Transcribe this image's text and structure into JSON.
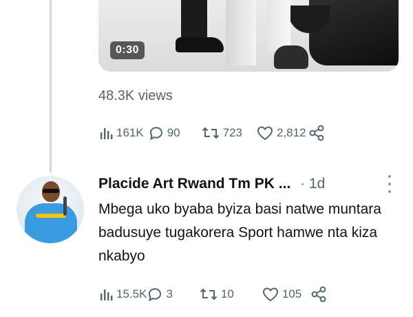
{
  "tweet": {
    "video_duration": "0:30",
    "views_label": "48.3K views",
    "stats": {
      "views": "161K",
      "replies": "90",
      "reposts": "723",
      "likes": "2,812"
    }
  },
  "reply": {
    "author_name": "Placide Art Rwand Tm PK ...",
    "separator": "·",
    "time": "1d",
    "text": "Mbega uko byaba byiza basi natwe muntara badusuye tugakorera Sport hamwe nta kiza nkabyo",
    "stats": {
      "views": "15.5K",
      "replies": "3",
      "reposts": "10",
      "likes": "105"
    }
  },
  "colors": {
    "secondary_text": "#536471",
    "primary_text": "#0f1419",
    "thread_line": "#cfd9de"
  },
  "icons": [
    "analytics-icon",
    "reply-icon",
    "repost-icon",
    "like-icon",
    "share-icon",
    "more-icon"
  ]
}
